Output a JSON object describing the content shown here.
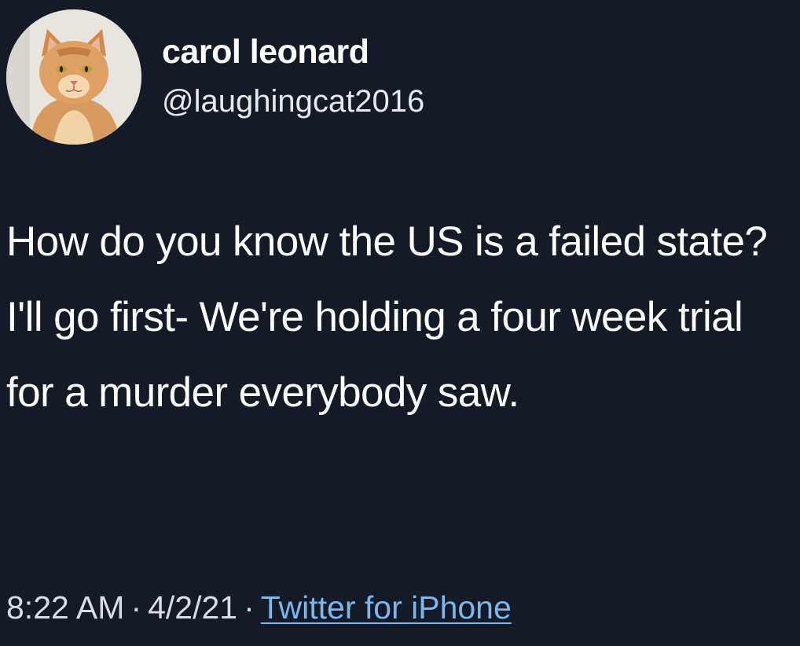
{
  "user": {
    "display_name": "carol leonard",
    "handle": "@laughingcat2016",
    "avatar_icon": "orange-tabby-cat-avatar"
  },
  "tweet": {
    "text": "How do you know the US is a failed state? I'll go first- We're holding a four week trial for a murder everybody saw."
  },
  "meta": {
    "time": "8:22 AM",
    "separator": "·",
    "date": "4/2/21",
    "source": "Twitter for iPhone"
  },
  "colors": {
    "background": "#151b26",
    "text": "#ffffff",
    "link": "#7db7ea"
  }
}
